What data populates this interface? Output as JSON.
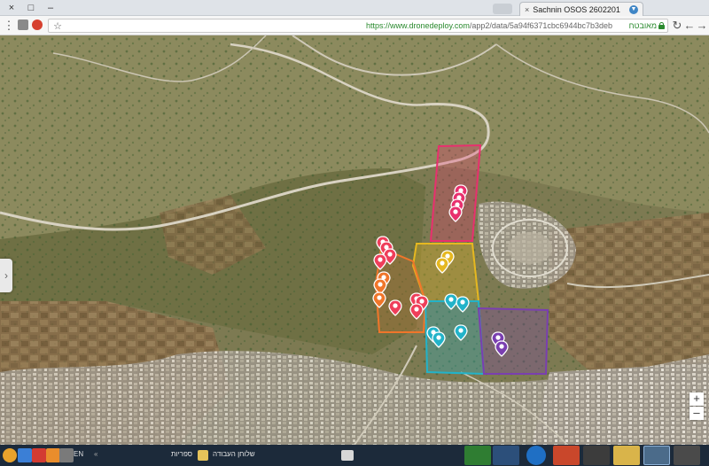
{
  "browser": {
    "tab_title": "Sachnin OSOS 2602201",
    "tab_close": "×",
    "url_host": "https://www.dronedeploy.com",
    "url_path": "/app2/data/5a94f6371cbc6944bc7b3deb",
    "secure_label": "מאובטח",
    "nav": {
      "back": "←",
      "forward": "→",
      "reload": "↻",
      "menu": "⋮",
      "star": "☆"
    },
    "window_buttons": {
      "minimize": "–",
      "maximize": "□",
      "close": "×"
    }
  },
  "map": {
    "left_handle": "›",
    "zoom_in": "+",
    "zoom_out": "–",
    "zones": [
      {
        "name": "magenta",
        "color": "#e8306e"
      },
      {
        "name": "yellow",
        "color": "#e6b820"
      },
      {
        "name": "orange",
        "color": "#f0762a"
      },
      {
        "name": "cyan",
        "color": "#22b3c9"
      },
      {
        "name": "purple",
        "color": "#7a3fb0"
      }
    ]
  },
  "taskbar": {
    "language": "EN",
    "desktop_label": "שלוחן העבודה",
    "libraries_label": "ספריות",
    "chevron": "«"
  }
}
